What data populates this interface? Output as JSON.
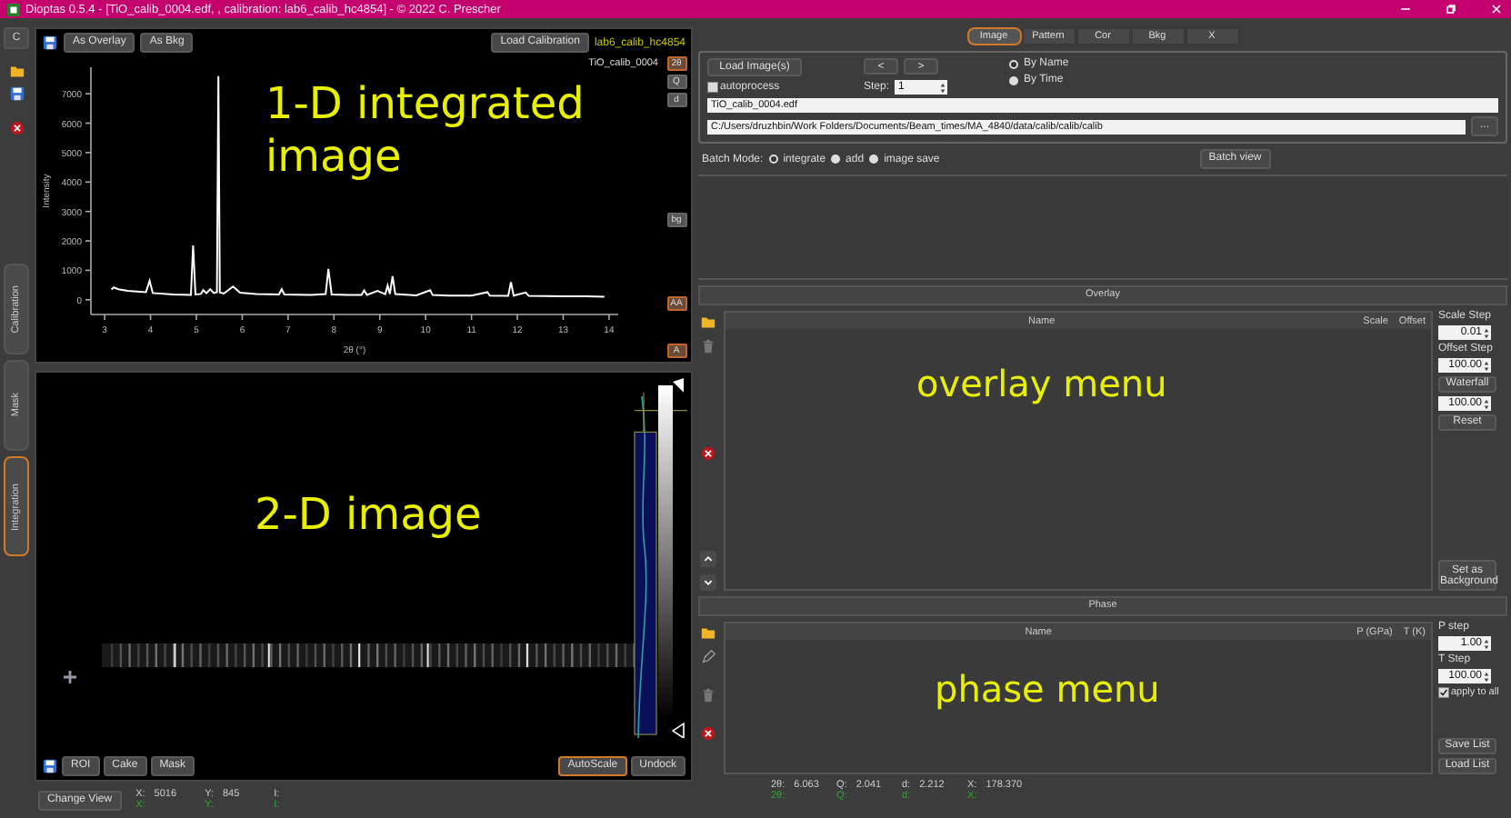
{
  "window": {
    "title": "Dioptas 0.5.4 - [TiO_calib_0004.edf, , calibration: lab6_calib_hc4854] - © 2022 C. Prescher"
  },
  "left_tabs": {
    "top_button": "C",
    "tabs": [
      {
        "label": "Calibration",
        "selected": false
      },
      {
        "label": "Mask",
        "selected": false
      },
      {
        "label": "Integration",
        "selected": true
      }
    ]
  },
  "pattern_panel": {
    "buttons": [
      "As Overlay",
      "As Bkg"
    ],
    "load_button": "Load Calibration",
    "calibration_name": "lab6_calib_hc4854",
    "annotation": "1-D integrated image",
    "unit_buttons": [
      {
        "label": "2θ",
        "selected": true
      },
      {
        "label": "Q",
        "selected": false
      },
      {
        "label": "d",
        "selected": false
      }
    ],
    "bg_button": "bg",
    "aa_button": {
      "label": "AA",
      "selected": true
    },
    "auto_button": {
      "label": "A",
      "selected": true
    },
    "chart_data": {
      "type": "line",
      "xlabel": "2θ (°)",
      "ylabel": "Intensity",
      "xlim": [
        2.7,
        14.2
      ],
      "ylim": [
        -500,
        7900
      ],
      "xticks": [
        3,
        4,
        5,
        6,
        7,
        8,
        9,
        10,
        11,
        12,
        13,
        14
      ],
      "yticks": [
        0,
        1000,
        2000,
        3000,
        4000,
        5000,
        6000,
        7000
      ],
      "x": [
        3.15,
        3.2,
        3.3,
        3.5,
        3.9,
        3.98,
        4.05,
        4.5,
        4.88,
        4.93,
        4.98,
        5.1,
        5.15,
        5.22,
        5.3,
        5.38,
        5.45,
        5.48,
        5.51,
        5.6,
        5.8,
        5.95,
        6.3,
        6.8,
        6.86,
        6.92,
        7.5,
        7.82,
        7.88,
        7.95,
        8.3,
        8.6,
        8.66,
        8.72,
        8.95,
        9.12,
        9.17,
        9.22,
        9.28,
        9.34,
        9.8,
        10.1,
        10.15,
        10.5,
        11.0,
        11.35,
        11.4,
        11.8,
        11.86,
        11.92,
        12.18,
        12.25,
        13.0,
        13.5,
        13.9
      ],
      "series": [
        {
          "name": "TiO_calib_0004",
          "color": "#ffffff",
          "values": [
            350,
            420,
            360,
            300,
            260,
            650,
            230,
            180,
            170,
            1850,
            180,
            200,
            330,
            220,
            360,
            230,
            260,
            7600,
            250,
            210,
            450,
            240,
            200,
            180,
            360,
            180,
            170,
            190,
            1050,
            180,
            160,
            170,
            320,
            170,
            300,
            190,
            480,
            200,
            800,
            190,
            150,
            330,
            160,
            140,
            140,
            260,
            140,
            130,
            600,
            140,
            250,
            130,
            120,
            120,
            100
          ]
        }
      ]
    }
  },
  "image_panel": {
    "annotation": "2-D image",
    "buttons": [
      "ROI",
      "Cake",
      "Mask"
    ],
    "autoscale": {
      "label": "AutoScale",
      "on": true
    },
    "undock_button": "Undock"
  },
  "left_status": {
    "button": "Change View",
    "readouts": [
      {
        "label": "X:",
        "value": "5016",
        "second": "X:"
      },
      {
        "label": "Y:",
        "value": "845",
        "second": "Y:"
      },
      {
        "label": "I:",
        "second": "I:"
      }
    ]
  },
  "right_tabs": [
    {
      "label": "Image",
      "selected": true
    },
    {
      "label": "Pattern",
      "selected": false
    },
    {
      "label": "Cor",
      "selected": false
    },
    {
      "label": "Bkg",
      "selected": false
    },
    {
      "label": "X",
      "selected": false
    }
  ],
  "image_group": {
    "load_button": "Load Image(s)",
    "prev_button": "<",
    "next_button": ">",
    "sort_options": [
      {
        "label": "By Name",
        "selected": true
      },
      {
        "label": "By Time",
        "selected": false
      }
    ],
    "autoprocess": {
      "label": "autoprocess",
      "checked": false
    },
    "step_label": "Step:",
    "step_value": "1",
    "filename": "TiO_calib_0004.edf",
    "path": "C:/Users/druzhbin/Work Folders/Documents/Beam_times/MA_4840/data/calib/calib/calib",
    "browse_button": "...",
    "batch_label": "Batch Mode:",
    "batch_modes": [
      {
        "label": "integrate",
        "selected": true
      },
      {
        "label": "add",
        "selected": false
      },
      {
        "label": "image save",
        "selected": false
      }
    ],
    "batch_view_button": "Batch view"
  },
  "overlay": {
    "header": "Overlay",
    "columns": [
      "Name",
      "Scale",
      "Offset"
    ],
    "annotation": "overlay menu",
    "scale_step_label": "Scale Step",
    "scale_step": "0.01",
    "offset_step_label": "Offset Step",
    "offset_step": "100.00",
    "waterfall_button": "Waterfall",
    "waterfall_value": "100.00",
    "reset_button": "Reset",
    "background_button": "Set as Background"
  },
  "phase": {
    "header": "Phase",
    "columns": [
      "Name",
      "P (GPa)",
      "T (K)"
    ],
    "annotation": "phase menu",
    "p_step_label": "P step",
    "p_step": "1.00",
    "t_step_label": "T Step",
    "t_step": "100.00",
    "apply_all": {
      "label": "apply to all",
      "checked": true
    },
    "save_button": "Save List",
    "load_button": "Load List"
  },
  "right_status": [
    {
      "label": "2θ:",
      "value": "6.063",
      "second": "2θ:"
    },
    {
      "label": "Q:",
      "value": "2.041",
      "second": "Q:"
    },
    {
      "label": "d:",
      "value": "2.212",
      "second": "d:"
    },
    {
      "label": "X:",
      "value": "178.370",
      "second": "X:"
    }
  ]
}
